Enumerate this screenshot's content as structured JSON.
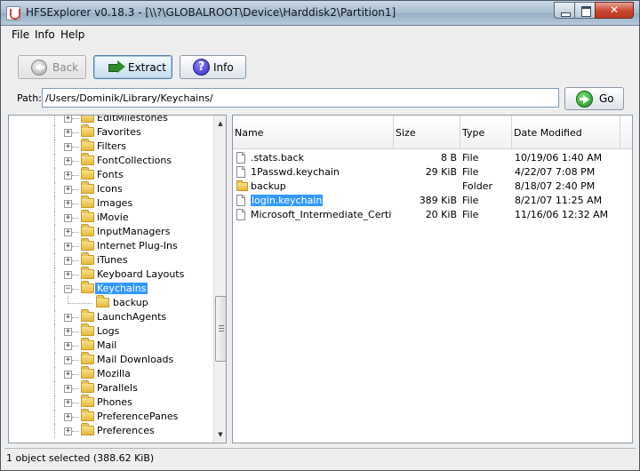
{
  "window": {
    "title": "HFSExplorer v0.18.3 - [\\\\?\\GLOBALROOT\\Device\\Harddisk2\\Partition1]"
  },
  "menu": [
    "File",
    "Info",
    "Help"
  ],
  "toolbar": {
    "back_label": "Back",
    "extract_label": "Extract",
    "info_label": "Info",
    "info_glyph": "?",
    "back_enabled": false
  },
  "path": {
    "label": "Path:",
    "value": "/Users/Dominik/Library/Keychains/",
    "go_label": "Go"
  },
  "tree": {
    "items": [
      {
        "label": "EditMilestones",
        "expander": "+"
      },
      {
        "label": "Favorites",
        "expander": "+"
      },
      {
        "label": "Filters",
        "expander": "+"
      },
      {
        "label": "FontCollections",
        "expander": "+"
      },
      {
        "label": "Fonts",
        "expander": "+"
      },
      {
        "label": "Icons",
        "expander": "+"
      },
      {
        "label": "Images",
        "expander": "+"
      },
      {
        "label": "iMovie",
        "expander": "+"
      },
      {
        "label": "InputManagers",
        "expander": "+"
      },
      {
        "label": "Internet Plug-Ins",
        "expander": "+"
      },
      {
        "label": "iTunes",
        "expander": "+"
      },
      {
        "label": "Keyboard Layouts",
        "expander": "+"
      },
      {
        "label": "Keychains",
        "expander": "−",
        "selected": true
      },
      {
        "label": "backup",
        "child": true
      },
      {
        "label": "LaunchAgents",
        "expander": "+"
      },
      {
        "label": "Logs",
        "expander": "+"
      },
      {
        "label": "Mail",
        "expander": "+"
      },
      {
        "label": "Mail Downloads",
        "expander": "+"
      },
      {
        "label": "Mozilla",
        "expander": "+"
      },
      {
        "label": "Parallels",
        "expander": "+"
      },
      {
        "label": "Phones",
        "expander": "+"
      },
      {
        "label": "PreferencePanes",
        "expander": "+"
      },
      {
        "label": "Preferences",
        "expander": "+"
      }
    ]
  },
  "table": {
    "columns": [
      "Name",
      "Size",
      "Type",
      "Date Modified"
    ],
    "rows": [
      {
        "name": ".stats.back",
        "size": "8 B",
        "type": "File",
        "date": "10/19/06 1:40 AM",
        "icon": "file-icon"
      },
      {
        "name": "1Passwd.keychain",
        "size": "29 KiB",
        "type": "File",
        "date": "4/22/07 7:08 PM",
        "icon": "file-icon"
      },
      {
        "name": "backup",
        "size": "",
        "type": "Folder",
        "date": "8/18/07 2:40 PM",
        "icon": "folder-icon"
      },
      {
        "name": "login.keychain",
        "size": "389 KiB",
        "type": "File",
        "date": "8/21/07 11:25 AM",
        "icon": "file-icon",
        "selected": true
      },
      {
        "name": "Microsoft_Intermediate_Certificates",
        "size": "20 KiB",
        "type": "File",
        "date": "11/16/06 12:32 AM",
        "icon": "file-icon"
      }
    ]
  },
  "status": {
    "text": "1 object selected (388.62 KiB)"
  },
  "colors": {
    "selection": "#3399ff",
    "folder": "#e8b93c"
  }
}
